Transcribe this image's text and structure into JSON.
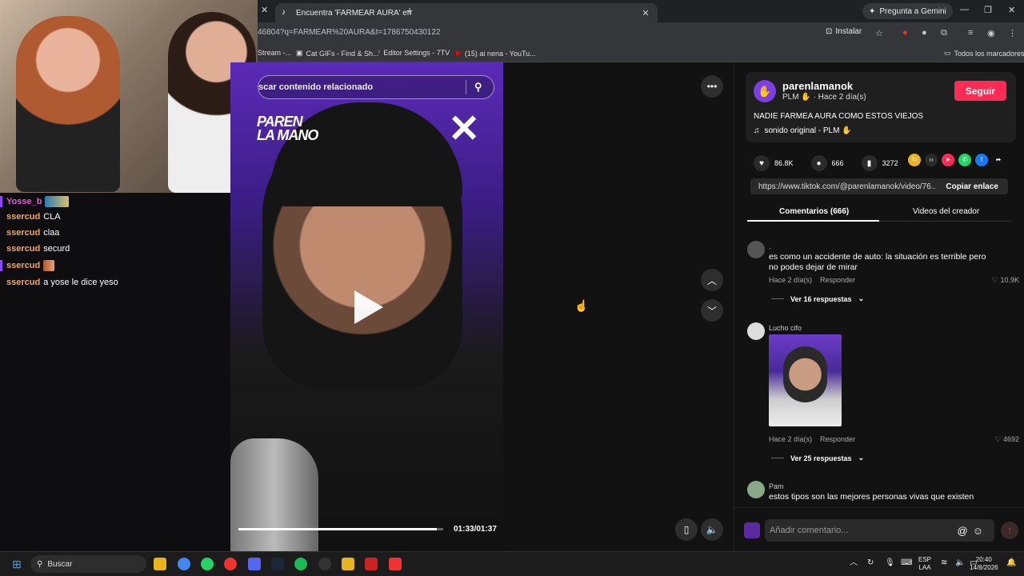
{
  "browser": {
    "tab_title": "Encuentra 'FARMEAR AURA' en",
    "url": "46804?q=FARMEAR%20AURA&t=1786750430122",
    "gemini_label": "Pregunta a Gemini",
    "install_label": "Instalar",
    "bookmarks": [
      {
        "label": "Stream -..."
      },
      {
        "label": "Cat GIFs - Find & Sh..."
      },
      {
        "label": "Editor Settings - 7TV"
      },
      {
        "label": "(15) ai nena - YouTu..."
      }
    ],
    "all_bookmarks": "Todos los marcadores"
  },
  "chat": {
    "messages": [
      {
        "user": "Yosse_b",
        "text": "",
        "user_color": "#e05ad8"
      },
      {
        "user": "ssercud",
        "text": "CLA",
        "user_color": "#f0a860"
      },
      {
        "user": "ssercud",
        "text": "claa",
        "user_color": "#f0a860"
      },
      {
        "user": "ssercud",
        "text": "securd",
        "user_color": "#f0a860"
      },
      {
        "user": "ssercud",
        "text": "",
        "user_color": "#f0a860"
      },
      {
        "user": "ssercud",
        "text": "a yose le dice yeso",
        "user_color": "#f0a860"
      }
    ]
  },
  "video": {
    "search_placeholder": "scar contenido relacionado",
    "logo_text_1": "PAREN",
    "logo_text_2": "LA MANO",
    "logo_x": "✕",
    "time": "01:33/01:37",
    "progress": 0.97
  },
  "panel": {
    "username": "parenlamanok",
    "meta": "PLM ✋ · Hace 2 día(s)",
    "follow_label": "Seguir",
    "description": "NADIE FARMEA AURA COMO ESTOS VIEJOS",
    "sound": "sonido original - PLM ✋",
    "likes": "86.8K",
    "comments_count": "666",
    "saves": "3272",
    "link": "https://www.tiktok.com/@parenlamanok/video/76...",
    "copy_label": "Copiar enlace",
    "tab_comments": "Comentarios (666)",
    "tab_videos": "Videos del creador",
    "comments": [
      {
        "name": ".",
        "text": "es como un accidente de auto: la situación es terrible pero no podes dejar de mirar",
        "time": "Hace 2 día(s)",
        "reply": "Responder",
        "likes": "10.9K",
        "more": "Ver 16 respuestas"
      },
      {
        "name": "Lucho cifo",
        "text": "",
        "time": "Hace 2 día(s)",
        "reply": "Responder",
        "likes": "4692",
        "more": "Ver 25 respuestas"
      },
      {
        "name": "Pam",
        "text": "estos tipos son las mejores personas vivas que existen"
      }
    ],
    "add_comment_placeholder": "Añadir comentario..."
  },
  "taskbar": {
    "search_label": "Buscar",
    "lang_1": "ESP",
    "lang_2": "LAA",
    "clock_time": "20:40",
    "clock_date": "14/8/2026"
  }
}
